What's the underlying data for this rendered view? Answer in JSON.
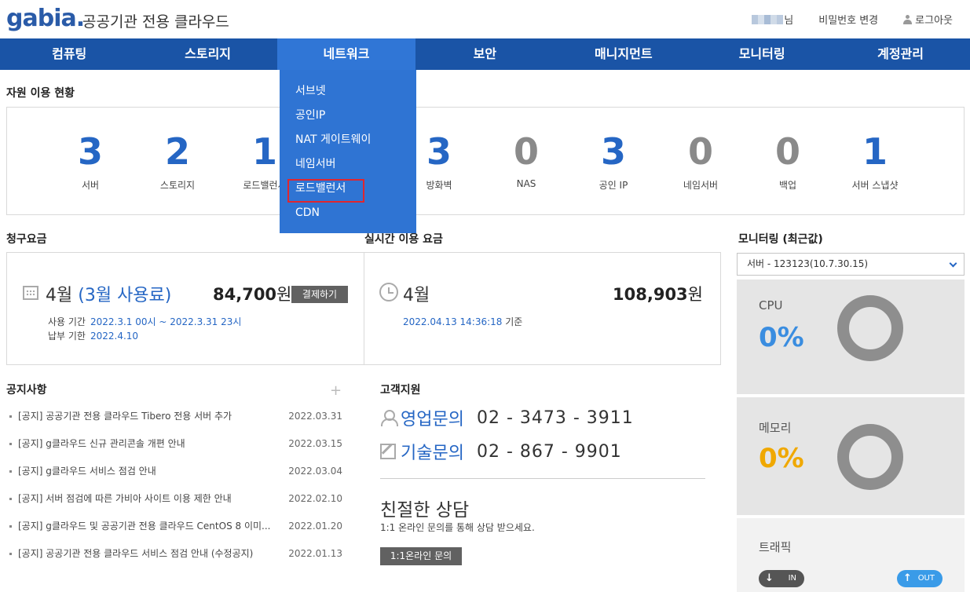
{
  "header": {
    "logo": "gabia",
    "logo_dot": ".",
    "subtitle": "공공기관 전용 클라우드",
    "user_suffix": "님",
    "change_password": "비밀번호 변경",
    "logout": "로그아웃"
  },
  "nav": {
    "items": [
      "컴퓨팅",
      "스토리지",
      "네트워크",
      "보안",
      "매니지먼트",
      "모니터링",
      "계정관리"
    ],
    "active": "네트워크"
  },
  "dropdown": {
    "items": [
      "서브넷",
      "공인IP",
      "NAT 게이트웨이",
      "네임서버",
      "로드밸런서",
      "CDN"
    ],
    "highlighted": "로드밸런서"
  },
  "resources": {
    "title": "자원 이용 현황",
    "items": [
      {
        "value": "3",
        "label": "서버"
      },
      {
        "value": "2",
        "label": "스토리지"
      },
      {
        "value": "1",
        "label": "로드밸런서"
      },
      {
        "value": "3",
        "label": "방화벽"
      },
      {
        "value": "0",
        "label": "NAS"
      },
      {
        "value": "3",
        "label": "공인 IP"
      },
      {
        "value": "0",
        "label": "네임서버"
      },
      {
        "value": "0",
        "label": "백업"
      },
      {
        "value": "1",
        "label": "서버 스냅샷"
      }
    ]
  },
  "billing": {
    "title": "청구요금",
    "month": "4월",
    "usage": "(3월 사용료)",
    "amount": "84,700",
    "currency": "원",
    "pay_button": "결제하기",
    "period_label": "사용 기간",
    "period_value": "2022.3.1 00시 ~ 2022.3.31 23시",
    "due_label": "납부 기한",
    "due_value": "2022.4.10"
  },
  "realtime": {
    "title": "실시간 이용 요금",
    "month": "4월",
    "amount": "108,903",
    "currency": "원",
    "timestamp": "2022.04.13 14:36:18",
    "timestamp_suffix": "기준"
  },
  "notices": {
    "title": "공지사항",
    "plus": "+",
    "items": [
      {
        "text": "[공지] 공공기관 전용 클라우드 Tibero 전용 서버 추가",
        "date": "2022.03.31"
      },
      {
        "text": "[공지] g클라우드 신규 관리콘솔 개편 안내",
        "date": "2022.03.15"
      },
      {
        "text": "[공지] g클라우드 서비스 점검 안내",
        "date": "2022.03.04"
      },
      {
        "text": "[공지] 서버 점검에 따른 가비아 사이트 이용 제한 안내",
        "date": "2022.02.10"
      },
      {
        "text": "[공지] g클라우드 및 공공기관 전용 클라우드 CentOS 8 이미...",
        "date": "2022.01.20"
      },
      {
        "text": "[공지] 공공기관 전용 클라우드 서비스 점검 안내 (수정공지)",
        "date": "2022.01.13"
      }
    ]
  },
  "support": {
    "title": "고객지원",
    "sales_label": "영업문의",
    "sales_phone": "02 - 3473 - 3911",
    "tech_label": "기술문의",
    "tech_phone": "02 - 867 - 9901",
    "consult_title": "친절한 상담",
    "consult_desc": "1:1 온라인 문의를 통해 상담 받으세요.",
    "consult_button": "1:1온라인 문의"
  },
  "monitoring": {
    "title": "모니터링 (최근값)",
    "selected_server": "서버 - 123123(10.7.30.15)",
    "cpu_label": "CPU",
    "cpu_value": "0%",
    "cpu_color": "#3a8de0",
    "memory_label": "메모리",
    "memory_value": "0%",
    "memory_color": "#f0a800",
    "traffic_label": "트래픽",
    "in_label": "IN",
    "out_label": "OUT"
  },
  "colors": {
    "nav_bg": "#1a54a6",
    "nav_active": "#3076d6",
    "accent": "#2566c4",
    "highlight_border": "#e0262f"
  }
}
